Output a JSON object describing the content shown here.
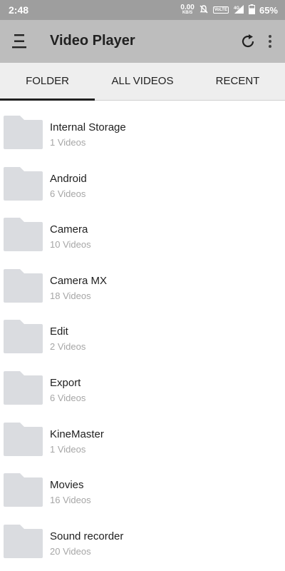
{
  "status_bar": {
    "time": "2:48",
    "net_speed_value": "0.00",
    "net_speed_unit": "KB/S",
    "volte": "VoLTE",
    "signal_label": "4G",
    "battery": "65%"
  },
  "app_bar": {
    "title": "Video Player",
    "icons": [
      "menu-icon",
      "refresh-icon",
      "more-vert-icon"
    ]
  },
  "tabs": [
    {
      "label": "FOLDER",
      "selected": true
    },
    {
      "label": "ALL VIDEOS",
      "selected": false
    },
    {
      "label": "RECENT",
      "selected": false
    }
  ],
  "folders": [
    {
      "name": "Internal Storage",
      "count": "1 Videos"
    },
    {
      "name": "Android",
      "count": "6 Videos"
    },
    {
      "name": "Camera",
      "count": "10 Videos"
    },
    {
      "name": "Camera MX",
      "count": "18 Videos"
    },
    {
      "name": "Edit",
      "count": "2 Videos"
    },
    {
      "name": "Export",
      "count": "6 Videos"
    },
    {
      "name": "KineMaster",
      "count": "1 Videos"
    },
    {
      "name": "Movies",
      "count": "16 Videos"
    },
    {
      "name": "Sound recorder",
      "count": "20 Videos"
    }
  ],
  "colors": {
    "status_bar": "#9e9e9e",
    "app_bar": "#bdbdbd",
    "tab_bar": "#eeeeee",
    "folder_icon": "#dadce0",
    "secondary_text": "#a6a6a6"
  }
}
